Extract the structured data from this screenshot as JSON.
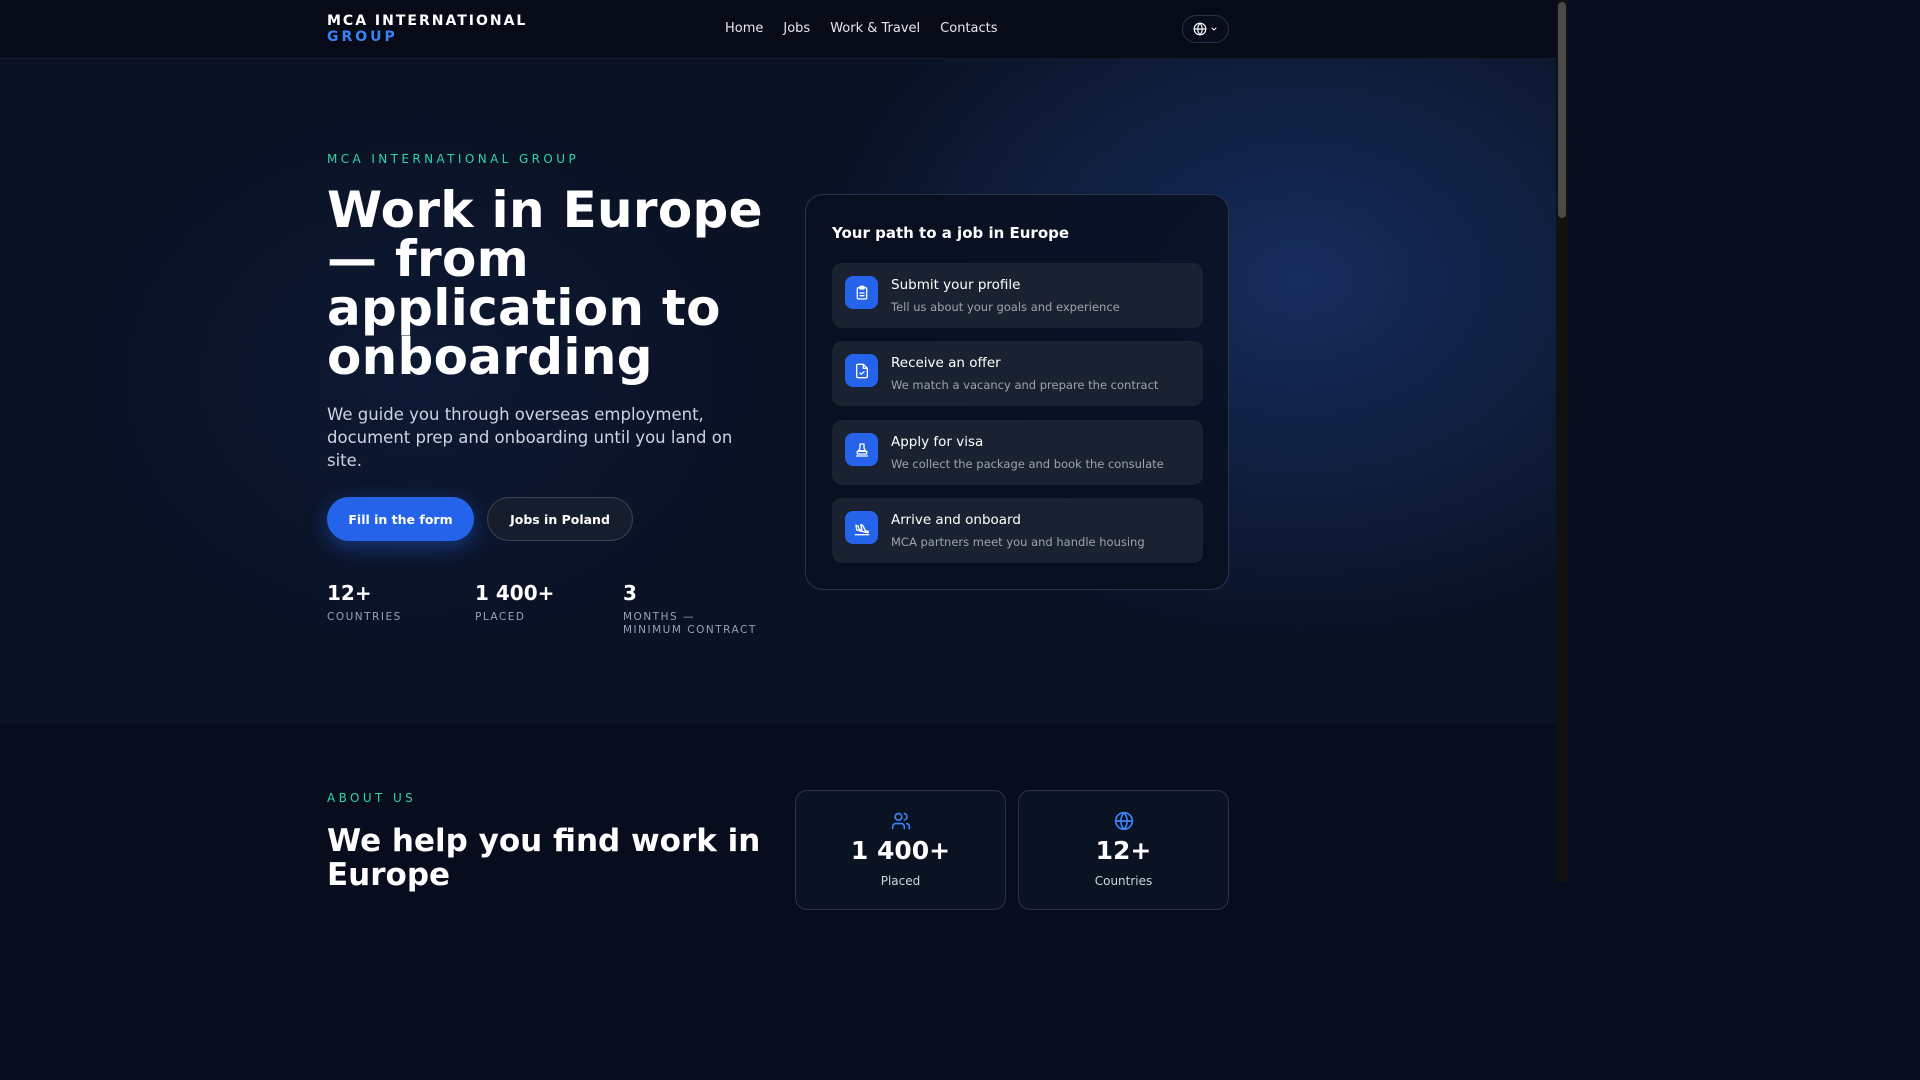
{
  "header": {
    "logo_line1": "MCA INTERNATIONAL",
    "logo_line2": "GROUP",
    "nav": [
      "Home",
      "Jobs",
      "Work & Travel",
      "Contacts"
    ],
    "language_icon": "globe-icon"
  },
  "hero": {
    "eyebrow": "MCA INTERNATIONAL GROUP",
    "title": "Work in Europe — from application to onboarding",
    "subtitle": "We guide you through overseas employment, document prep and onboarding until you land on site.",
    "primary_button": "Fill in the form",
    "secondary_button": "Jobs in Poland",
    "stats": [
      {
        "value": "12+",
        "label": "COUNTRIES"
      },
      {
        "value": "1 400+",
        "label": "PLACED"
      },
      {
        "value": "3",
        "label": "MONTHS — MINIMUM CONTRACT"
      }
    ]
  },
  "steps": {
    "title": "Your path to a job in Europe",
    "items": [
      {
        "title": "Submit your profile",
        "desc": "Tell us about your goals and experience",
        "icon": "clipboard-icon"
      },
      {
        "title": "Receive an offer",
        "desc": "We match a vacancy and prepare the contract",
        "icon": "document-check-icon"
      },
      {
        "title": "Apply for visa",
        "desc": "We collect the package and book the consulate",
        "icon": "stamp-icon"
      },
      {
        "title": "Arrive and onboard",
        "desc": "MCA partners meet you and handle housing",
        "icon": "plane-landing-icon"
      }
    ]
  },
  "about": {
    "eyebrow": "ABOUT US",
    "title": "We help you find work in Europe",
    "cards": [
      {
        "value": "1 400+",
        "label": "Placed",
        "icon": "users-icon"
      },
      {
        "value": "12+",
        "label": "Countries",
        "icon": "globe-icon"
      }
    ]
  },
  "colors": {
    "accent": "#2563eb",
    "eyebrow": "#2dd4a8",
    "background": "#070d1c"
  }
}
